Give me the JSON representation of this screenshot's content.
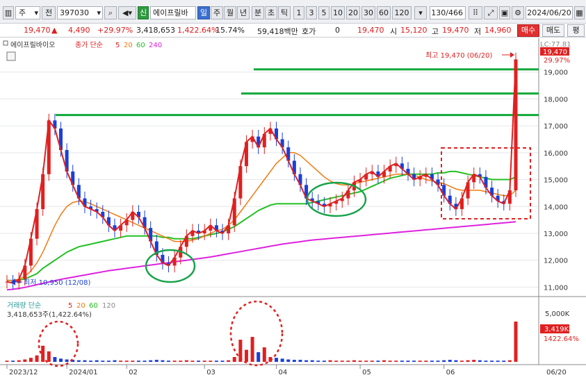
{
  "toolbar": {
    "type_value": "주",
    "market_value": "전",
    "code": "397030",
    "badge_new": "신",
    "stock_name": "에이프릴바",
    "period_tabs": [
      "일",
      "주",
      "월",
      "년",
      "분",
      "초",
      "틱"
    ],
    "minute_options": [
      "1",
      "3",
      "5",
      "10",
      "20",
      "30",
      "60",
      "120"
    ],
    "range": "130/466",
    "date": "2024/06/20"
  },
  "quote": {
    "price": "19,470",
    "change": "4,490",
    "change_pct": "+29.97%",
    "volume": "3,418,653",
    "volume_ratio": "1,422.64%",
    "turnover": "15.74%",
    "amount": "59,418백만",
    "hoga_label": "호가",
    "hoga_value": "0",
    "close": "19,470",
    "open_label": "시",
    "open": "15,120",
    "high_label": "고",
    "high": "19,470",
    "low_label": "저",
    "low": "14,960",
    "buy_label": "매수",
    "sell_label": "매도",
    "eval_label": "평"
  },
  "chart_legend": {
    "name": "에이프릴바이오",
    "label": "종가 단순",
    "ma": [
      "5",
      "20",
      "60",
      "240"
    ],
    "ma_colors": [
      "#e02020",
      "#f07a10",
      "#22c022",
      "#dd22dd"
    ]
  },
  "annotations": {
    "high_note": "최고 19,470 (06/20)",
    "low_note": "최저 10,950 (12/08)",
    "lc_label": "LC:77.81",
    "price_tag": "19,470",
    "pct_tag": "29.97%",
    "vol_tag": "3,419K",
    "vol_pct_tag": "1422.64%"
  },
  "volume_legend": {
    "label": "거래량 단순",
    "ma": [
      "5",
      "20",
      "60",
      "120"
    ],
    "value": "3,418,653주(1,422.64%)"
  },
  "chart_data": {
    "type": "candlestick",
    "y_ticks": [
      "19,000",
      "18,000",
      "17,000",
      "16,000",
      "15,000",
      "14,000",
      "13,000",
      "12,000",
      "11,000"
    ],
    "ylim": [
      10700,
      20000
    ],
    "vol_ticks": [
      "5,000K"
    ],
    "x_labels": [
      "2023/12",
      "2024/01",
      "02",
      "03",
      "04",
      "05",
      "06",
      "06/20"
    ],
    "close_line": [
      11200,
      11150,
      11300,
      11800,
      12800,
      13900,
      15200,
      17200,
      16900,
      16100,
      15300,
      14800,
      14300,
      14000,
      13900,
      13800,
      13600,
      13300,
      13100,
      13300,
      13500,
      13800,
      13600,
      13200,
      12700,
      12200,
      11900,
      11800,
      12100,
      12500,
      12900,
      13100,
      13000,
      13100,
      13300,
      13100,
      13000,
      13300,
      14300,
      15500,
      16400,
      16600,
      16200,
      16700,
      16900,
      16500,
      16200,
      15700,
      15200,
      14800,
      14300,
      14200,
      14100,
      14000,
      14100,
      14200,
      14300,
      14600,
      14900,
      15000,
      15200,
      15300,
      15100,
      15300,
      15500,
      15600,
      15400,
      15200,
      15000,
      15100,
      15200,
      15000,
      14800,
      14400,
      14100,
      13900,
      14300,
      14900,
      15200,
      15100,
      14700,
      14400,
      14200,
      14100,
      14600,
      19470
    ],
    "ma20": [
      11250,
      11250,
      11300,
      11400,
      11600,
      11900,
      12300,
      12800,
      13300,
      13700,
      14000,
      14150,
      14200,
      14180,
      14100,
      14000,
      13900,
      13800,
      13700,
      13600,
      13500,
      13400,
      13300,
      13200,
      13100,
      13000,
      12900,
      12800,
      12700,
      12700,
      12700,
      12750,
      12800,
      12900,
      13000,
      13100,
      13150,
      13300,
      13500,
      13800,
      14100,
      14400,
      14700,
      15000,
      15300,
      15600,
      15800,
      16000,
      16000,
      15900,
      15700,
      15500,
      15300,
      15100,
      14950,
      14850,
      14800,
      14800,
      14850,
      14900,
      14950,
      15000,
      15050,
      15100,
      15150,
      15200,
      15200,
      15200,
      15150,
      15100,
      15000,
      14950,
      14900,
      14850,
      14750,
      14650,
      14600,
      14600,
      14600,
      14600,
      14550,
      14500,
      14450,
      14400,
      14400,
      14600
    ],
    "ma60": [
      11250,
      11250,
      11270,
      11300,
      11400,
      11500,
      11700,
      11850,
      12000,
      12150,
      12300,
      12400,
      12500,
      12550,
      12600,
      12650,
      12700,
      12750,
      12800,
      12850,
      12900,
      12900,
      12900,
      12900,
      12900,
      12900,
      12850,
      12850,
      12800,
      12800,
      12800,
      12800,
      12850,
      12900,
      12950,
      13000,
      13050,
      13150,
      13250,
      13400,
      13550,
      13700,
      13850,
      13950,
      14050,
      14100,
      14100,
      14100,
      14100,
      14100,
      14100,
      14150,
      14200,
      14250,
      14300,
      14350,
      14400,
      14450,
      14500,
      14550,
      14650,
      14750,
      14850,
      14950,
      15050,
      15100,
      15150,
      15200,
      15200,
      15200,
      15200,
      15200,
      15250,
      15250,
      15300,
      15300,
      15250,
      15200,
      15150,
      15100,
      15050,
      15000,
      15000,
      15000,
      15000,
      15100
    ],
    "ma240": [
      10900,
      10920,
      10950,
      10990,
      11040,
      11090,
      11140,
      11190,
      11240,
      11290,
      11330,
      11370,
      11410,
      11450,
      11490,
      11530,
      11570,
      11610,
      11640,
      11670,
      11700,
      11730,
      11760,
      11790,
      11820,
      11850,
      11880,
      11910,
      11940,
      11970,
      12000,
      12030,
      12060,
      12090,
      12120,
      12160,
      12200,
      12240,
      12280,
      12320,
      12360,
      12400,
      12440,
      12480,
      12520,
      12560,
      12600,
      12630,
      12660,
      12690,
      12720,
      12750,
      12770,
      12790,
      12810,
      12830,
      12850,
      12870,
      12890,
      12910,
      12930,
      12950,
      12970,
      12990,
      13010,
      13030,
      13050,
      13070,
      13090,
      13110,
      13130,
      13150,
      13170,
      13190,
      13210,
      13230,
      13250,
      13270,
      13290,
      13310,
      13330,
      13350,
      13370,
      13390,
      13410,
      13430
    ],
    "resistance_lines": [
      19100,
      18200,
      17400
    ],
    "volume": [
      3,
      3,
      4,
      6,
      10,
      16,
      40,
      26,
      12,
      8,
      6,
      5,
      4,
      4,
      3,
      4,
      3,
      3,
      4,
      3,
      3,
      3,
      3,
      3,
      4,
      5,
      4,
      3,
      3,
      3,
      4,
      3,
      3,
      3,
      3,
      3,
      3,
      4,
      12,
      55,
      30,
      62,
      24,
      36,
      12,
      10,
      8,
      6,
      5,
      5,
      4,
      4,
      3,
      3,
      4,
      3,
      3,
      3,
      4,
      3,
      3,
      3,
      3,
      4,
      3,
      3,
      3,
      3,
      3,
      3,
      3,
      3,
      3,
      4,
      5,
      4,
      3,
      4,
      5,
      4,
      3,
      3,
      3,
      3,
      4,
      100
    ]
  }
}
